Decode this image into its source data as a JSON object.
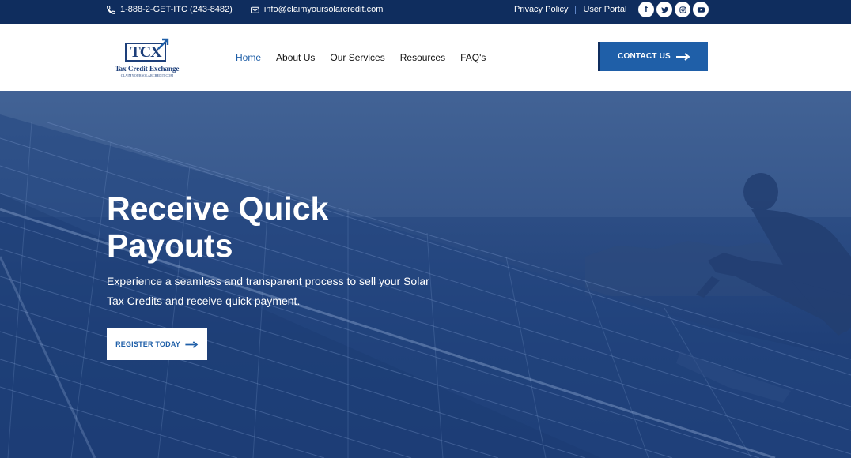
{
  "topbar": {
    "phone": "1-888-2-GET-ITC (243-8482)",
    "email": "info@claimyoursolarcredit.com",
    "links": [
      "Privacy Policy",
      "User Portal"
    ],
    "social_icons": [
      "facebook-icon",
      "twitter-icon",
      "instagram-icon",
      "youtube-icon"
    ]
  },
  "logo": {
    "mark": "TCX",
    "name": "Tax Credit Exchange",
    "url": "CLAIMYOURSOLARCREDIT.COM"
  },
  "nav": {
    "items": [
      "Home",
      "About Us",
      "Our Services",
      "Resources",
      "FAQ's"
    ],
    "active": "Home"
  },
  "header_cta": {
    "label": "CONTACT US"
  },
  "hero": {
    "title": "Receive Quick Payouts",
    "description": "Experience a seamless and transparent process to sell your Solar Tax Credits and receive quick payment.",
    "button_label": "REGISTER TODAY"
  },
  "colors": {
    "topbar": "#0f2d5e",
    "accent": "#1f5fa8",
    "hero_overlay": "#1f3f78"
  }
}
